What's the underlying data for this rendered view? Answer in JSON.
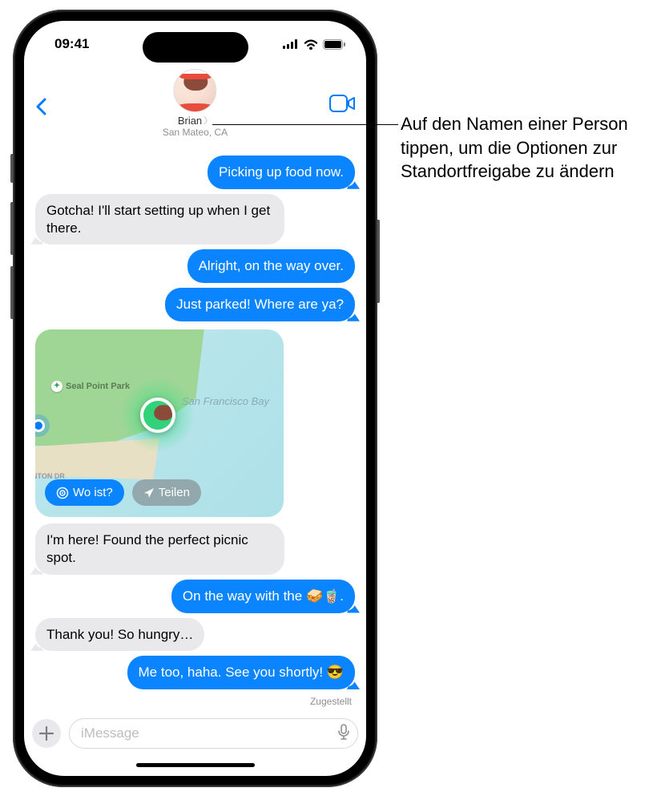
{
  "status": {
    "time": "09:41"
  },
  "header": {
    "contact_name": "Brian",
    "contact_location": "San Mateo, CA"
  },
  "messages": {
    "m1": "Picking up food now.",
    "m2": "Gotcha! I'll start setting up when I get there.",
    "m3": "Alright, on the way over.",
    "m4": "Just parked! Where are ya?",
    "m5": "I'm here! Found the perfect picnic spot.",
    "m6": "On the way with the 🥪🧋.",
    "m7": "Thank you! So hungry…",
    "m8": "Me too, haha. See you shortly! 😎"
  },
  "map": {
    "poi": "Seal Point Park",
    "bay": "San Francisco Bay",
    "road": "NTON DR",
    "findmy_label": "Wo ist?",
    "share_label": "Teilen"
  },
  "delivered_label": "Zugestellt",
  "composer": {
    "placeholder": "iMessage"
  },
  "callout": "Auf den Namen einer Person tippen, um die Optionen zur Standortfreigabe zu ändern"
}
